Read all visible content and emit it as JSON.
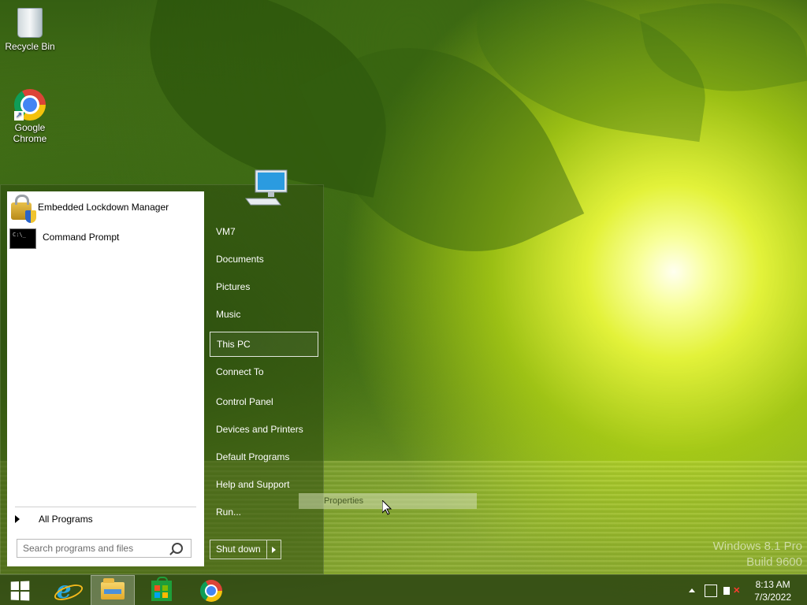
{
  "desktop": {
    "icons": [
      {
        "label": "Recycle Bin"
      },
      {
        "label": "Google Chrome"
      }
    ]
  },
  "start_menu": {
    "pinned_programs": [
      {
        "label": "Embedded Lockdown Manager",
        "icon": "lock-shield-icon"
      },
      {
        "label": "Command Prompt",
        "icon": "command-prompt-icon"
      }
    ],
    "all_programs_label": "All Programs",
    "search": {
      "placeholder": "Search programs and files",
      "value": ""
    },
    "right_items": [
      {
        "label": "VM7"
      },
      {
        "label": "Documents"
      },
      {
        "label": "Pictures"
      },
      {
        "label": "Music"
      },
      {
        "label": "This PC",
        "selected": true
      },
      {
        "label": "Connect To"
      },
      {
        "label": "Control Panel"
      },
      {
        "label": "Devices and Printers"
      },
      {
        "label": "Default Programs"
      },
      {
        "label": "Help and Support"
      },
      {
        "label": "Run..."
      }
    ],
    "shutdown_label": "Shut down"
  },
  "context_menu": {
    "item": "Properties"
  },
  "watermark": {
    "line1": "Windows 8.1 Pro",
    "line2": "Build 9600"
  },
  "taskbar": {
    "pinned": [
      "start-windows-icon",
      "internet-explorer-icon",
      "file-explorer-icon",
      "store-icon",
      "chrome-icon"
    ],
    "clock": {
      "time": "8:13 AM",
      "date": "7/3/2022"
    }
  },
  "colors": {
    "accent": "#2f5212",
    "taskbar": "#233c0f",
    "start_panel": "#2d4b0f"
  }
}
